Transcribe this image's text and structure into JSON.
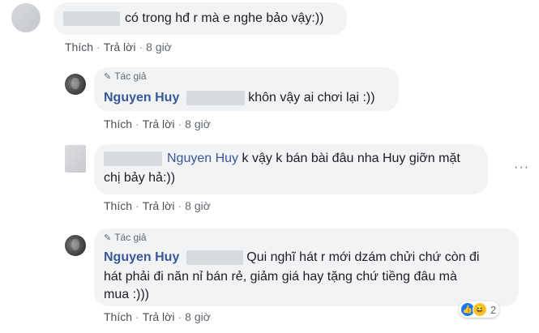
{
  "comments": [
    {
      "text": "có trong hđ r mà e nghe bảo vậy:))",
      "actions": {
        "like": "Thích",
        "reply": "Trả lời",
        "time": "8 giờ"
      }
    },
    {
      "author_badge": "Tác giả",
      "name": "Nguyen Huy",
      "text": "khôn vậy ai chơi lại :))",
      "actions": {
        "like": "Thích",
        "reply": "Trả lời",
        "time": "8 giờ"
      }
    },
    {
      "tag": "Nguyen Huy",
      "text_line1": "k vậy k bán bài đâu nha Huy giỡn mặt",
      "text_line2": "chị bảy hả:))",
      "actions": {
        "like": "Thích",
        "reply": "Trả lời",
        "time": "8 giờ"
      }
    },
    {
      "author_badge": "Tác giả",
      "name": "Nguyen Huy",
      "text_line1": "Qui nghĩ hát r mới dzám chửi chứ còn đi",
      "text_line2": "hát phải đi năn nỉ bán rẻ, giảm giá hay tặng chứ tiềng đâu mà",
      "text_line3": "mua :)))",
      "actions": {
        "like": "Thích",
        "reply": "Trả lời",
        "time": "8 giờ"
      },
      "reactions": {
        "icons": [
          "like-icon",
          "haha-icon"
        ],
        "count": "2"
      }
    }
  ],
  "more_options": "···"
}
